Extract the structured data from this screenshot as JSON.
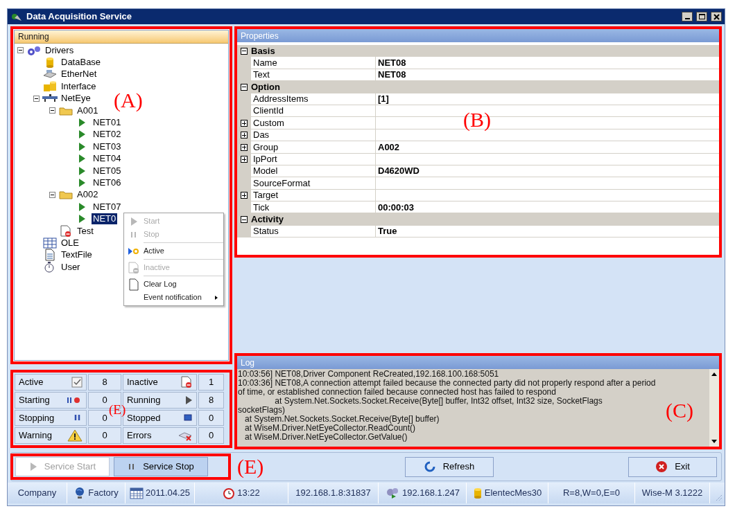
{
  "window": {
    "title": "Data Acquisition Service"
  },
  "running_panel": {
    "title": "Running",
    "annotation": "(A)",
    "tree": [
      {
        "label": "Drivers",
        "kind": "drivers",
        "expanded": true,
        "selected": false,
        "children": [
          {
            "label": "DataBase",
            "kind": "database",
            "selected": false
          },
          {
            "label": "EtherNet",
            "kind": "ethernet",
            "selected": false
          },
          {
            "label": "Interface",
            "kind": "interface",
            "selected": false
          },
          {
            "label": "NetEye",
            "kind": "network",
            "expanded": true,
            "selected": false,
            "children": [
              {
                "label": "A001",
                "kind": "folder",
                "expanded": true,
                "selected": false,
                "children": [
                  {
                    "label": "NET01",
                    "kind": "device",
                    "selected": false
                  },
                  {
                    "label": "NET02",
                    "kind": "device",
                    "selected": false
                  },
                  {
                    "label": "NET03",
                    "kind": "device",
                    "selected": false
                  },
                  {
                    "label": "NET04",
                    "kind": "device",
                    "selected": false
                  },
                  {
                    "label": "NET05",
                    "kind": "device",
                    "selected": false
                  },
                  {
                    "label": "NET06",
                    "kind": "device",
                    "selected": false
                  }
                ]
              },
              {
                "label": "A002",
                "kind": "folder",
                "expanded": true,
                "selected": false,
                "children": [
                  {
                    "label": "NET07",
                    "kind": "device",
                    "selected": false
                  },
                  {
                    "label": "NET0",
                    "kind": "device",
                    "selected": true
                  }
                ]
              },
              {
                "label": "Test",
                "kind": "test",
                "selected": false
              }
            ]
          },
          {
            "label": "OLE",
            "kind": "table",
            "selected": false
          },
          {
            "label": "TextFile",
            "kind": "textfile",
            "selected": false
          },
          {
            "label": "User",
            "kind": "user",
            "selected": false
          }
        ]
      }
    ]
  },
  "context_menu": {
    "items": [
      {
        "label": "Start",
        "kind": "start",
        "disabled": true,
        "separator_before": false
      },
      {
        "label": "Stop",
        "kind": "stop",
        "disabled": true,
        "separator_before": false
      },
      {
        "label": "Active",
        "kind": "active",
        "disabled": false,
        "separator_before": true
      },
      {
        "label": "Inactive",
        "kind": "inactive",
        "disabled": true,
        "separator_before": true
      },
      {
        "label": "Clear Log",
        "kind": "page",
        "disabled": false,
        "separator_before": true
      },
      {
        "label": "Event notification",
        "kind": "submenu",
        "disabled": false,
        "separator_before": false
      }
    ]
  },
  "status_counts": {
    "annotation": "(E)",
    "items": [
      {
        "label": "Active",
        "kind": "check",
        "value": "8"
      },
      {
        "label": "Inactive",
        "kind": "inactive",
        "value": "1"
      },
      {
        "label": "Starting",
        "kind": "starting",
        "value": "0"
      },
      {
        "label": "Running",
        "kind": "running",
        "value": "8"
      },
      {
        "label": "Stopping",
        "kind": "stopping",
        "value": "0"
      },
      {
        "label": "Stopped",
        "kind": "stopped",
        "value": "0"
      },
      {
        "label": "Warning",
        "kind": "warning",
        "value": "0"
      },
      {
        "label": "Errors",
        "kind": "errors",
        "value": "0"
      }
    ]
  },
  "properties": {
    "title": "Properties",
    "annotation": "(B)",
    "categories": [
      {
        "name": "Basis",
        "expanded": true,
        "rows": [
          {
            "name": "Name",
            "value": "NET08",
            "expandable": false
          },
          {
            "name": "Text",
            "value": "NET08",
            "expandable": false
          }
        ]
      },
      {
        "name": "Option",
        "expanded": true,
        "rows": [
          {
            "name": "AddressItems",
            "value": "[1]",
            "expandable": false
          },
          {
            "name": "ClientId",
            "expandable": false
          },
          {
            "name": "Custom",
            "expandable": true
          },
          {
            "name": "Das",
            "expandable": true
          },
          {
            "name": "Group",
            "value": "A002",
            "expandable": true
          },
          {
            "name": "IpPort",
            "expandable": true
          },
          {
            "name": "Model",
            "value": "D4620WD",
            "expandable": false
          },
          {
            "name": "SourceFormat",
            "expandable": false
          },
          {
            "name": "Target",
            "expandable": true
          },
          {
            "name": "Tick",
            "value": "00:00:03",
            "expandable": false
          }
        ]
      },
      {
        "name": "Activity",
        "expanded": true,
        "rows": [
          {
            "name": "Status",
            "value": "True",
            "expandable": false
          }
        ]
      }
    ]
  },
  "log": {
    "title": "Log",
    "annotation": "(C)",
    "lines": [
      "10:03:56] NET08,Driver Component ReCreated,192.168.100.168:5051",
      "10:03:36] NET08,A connection attempt failed because the connected party did not properly respond after a period",
      "of time, or established connection failed because connected host has failed to respond",
      "                at System.Net.Sockets.Socket.Receive(Byte[] buffer, Int32 offset, Int32 size, SocketFlags",
      "socketFlags)",
      "   at System.Net.Sockets.Socket.Receive(Byte[] buffer)",
      "   at WiseM.Driver.NetEyeCollector.ReadCount()",
      "   at WiseM.Driver.NetEyeCollector.GetValue()"
    ]
  },
  "service_buttons": {
    "annotation": "(E)",
    "buttons": [
      {
        "label": "Service Start",
        "kind": "start",
        "disabled": true
      },
      {
        "label": "Service Stop",
        "kind": "stop",
        "disabled": false
      }
    ]
  },
  "actions": [
    {
      "label": "Refresh",
      "kind": "refresh"
    },
    {
      "label": "Exit",
      "kind": "exit"
    }
  ],
  "status_bar": [
    {
      "text": "Company",
      "kind": "plain"
    },
    {
      "text": "Factory",
      "kind": "globe"
    },
    {
      "text": "2011.04.25",
      "kind": "calendar"
    },
    {
      "text": "13:22",
      "kind": "clock"
    },
    {
      "text": "192.168.1.8:31837",
      "kind": "plain"
    },
    {
      "text": "192.168.1.247",
      "kind": "server"
    },
    {
      "text": "ElentecMes30",
      "kind": "database"
    },
    {
      "text": "R=8,W=0,E=0",
      "kind": "plain"
    },
    {
      "text": "Wise-M 3.1222",
      "kind": "plain"
    }
  ]
}
